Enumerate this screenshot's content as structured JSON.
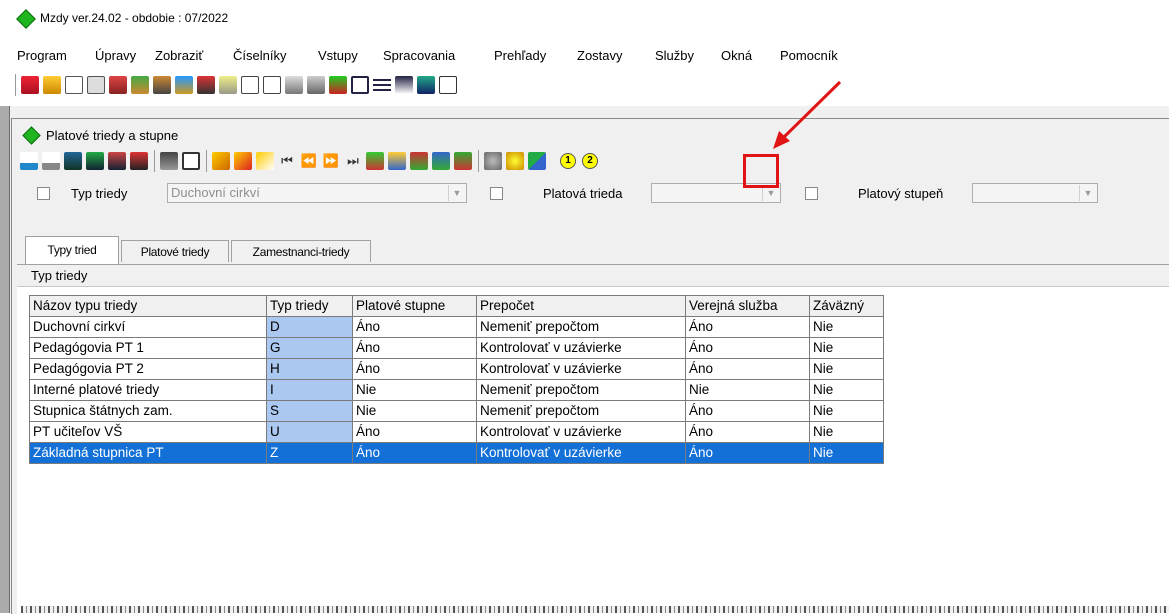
{
  "window": {
    "title": "Mzdy ver.24.02 - obdobie : 07/2022"
  },
  "menu": [
    {
      "label": "Program"
    },
    {
      "label": "Úpravy"
    },
    {
      "label": "Zobraziť"
    },
    {
      "label": "Číselníky"
    },
    {
      "label": "Vstupy"
    },
    {
      "label": "Spracovania"
    },
    {
      "label": "Prehľady"
    },
    {
      "label": "Zostavy"
    },
    {
      "label": "Služby"
    },
    {
      "label": "Okná"
    },
    {
      "label": "Pomocník"
    }
  ],
  "child": {
    "title": "Platové triedy a stupne"
  },
  "toolbar2": {
    "circle1": "1",
    "circle2": "2"
  },
  "filter": {
    "typ_label": "Typ triedy",
    "typ_value": "Duchovní cirkví",
    "trieda_label": "Platová trieda",
    "trieda_value": "",
    "stupen_label": "Platový stupeň",
    "stupen_value": ""
  },
  "tabs": [
    {
      "label": "Typy tried",
      "active": true
    },
    {
      "label": "Platové triedy",
      "active": false
    },
    {
      "label": "Zamestnanci-triedy",
      "active": false
    }
  ],
  "panel": {
    "heading": "Typ triedy"
  },
  "grid": {
    "columns": [
      "Názov typu triedy",
      "Typ triedy",
      "Platové stupne",
      "Prepočet",
      "Verejná služba",
      "Záväzný"
    ],
    "rows": [
      [
        "Duchovní cirkví",
        "D",
        "Áno",
        "Nemeniť prepočtom",
        "Áno",
        "Nie"
      ],
      [
        "Pedagógovia PT 1",
        "G",
        "Áno",
        "Kontrolovať v uzávierke",
        "Áno",
        "Nie"
      ],
      [
        "Pedagógovia PT 2",
        "H",
        "Áno",
        "Kontrolovať v uzávierke",
        "Áno",
        "Nie"
      ],
      [
        "Interné platové triedy",
        "I",
        "Nie",
        "Nemeniť prepočtom",
        "Nie",
        "Nie"
      ],
      [
        "Stupnica štátnych zam.",
        "S",
        "Nie",
        "Nemeniť prepočtom",
        "Áno",
        "Nie"
      ],
      [
        "PT učiteľov VŠ",
        "U",
        "Áno",
        "Kontrolovať v uzávierke",
        "Áno",
        "Nie"
      ],
      [
        "Základná stupnica PT",
        "Z",
        "Áno",
        "Kontrolovať v uzávierke",
        "Áno",
        "Nie"
      ]
    ],
    "selected_row": 6
  },
  "colors": {
    "accent": "#1270d6",
    "code_cell": "#aac8f0",
    "highlight": "#e01414",
    "app_icon": "#1fb51f"
  }
}
